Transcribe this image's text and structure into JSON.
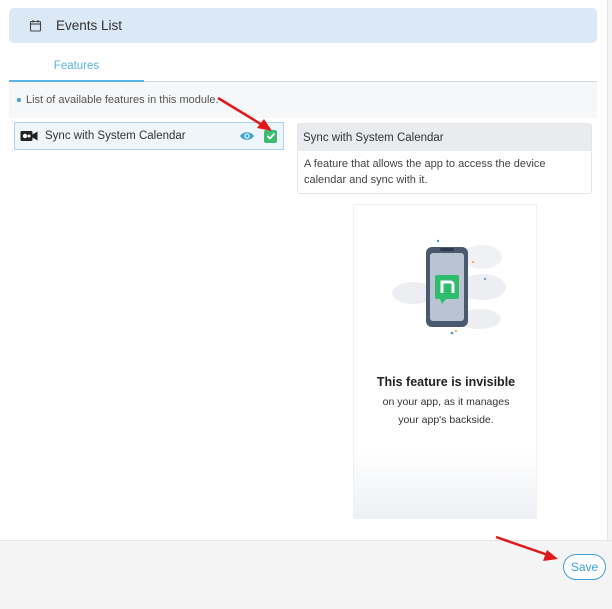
{
  "header": {
    "title": "Events List",
    "icon": "calendar-icon"
  },
  "tabs": [
    {
      "label": "Features",
      "active": true
    }
  ],
  "info": {
    "text": "List of available features in this module."
  },
  "features": [
    {
      "name": "Sync with System Calendar",
      "icon": "video-camera-icon",
      "preview_icon": "eye-icon",
      "enabled": true
    }
  ],
  "detail": {
    "title": "Sync with System Calendar",
    "description": "A feature that allows the app to access the device calendar and sync with it."
  },
  "preview": {
    "title": "This feature is invisible",
    "line1": "on your app, as it manages",
    "line2": "your app's backside."
  },
  "footer": {
    "save_label": "Save"
  },
  "colors": {
    "accent": "#3fa1d6",
    "check": "#3dbb6f",
    "header_bg": "#dbe8f5",
    "annotation_arrow": "#e0181b"
  }
}
